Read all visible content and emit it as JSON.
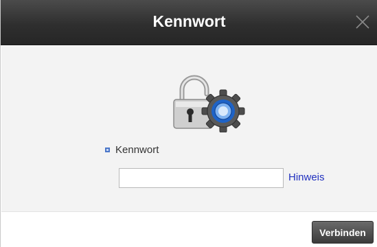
{
  "dialog": {
    "title": "Kennwort",
    "close_icon": "close-icon"
  },
  "form": {
    "icon": "lock-gear-icon",
    "password_label": "Kennwort",
    "password_value": "",
    "password_placeholder": "",
    "hint_link": "Hinweis"
  },
  "footer": {
    "connect_label": "Verbinden"
  },
  "colors": {
    "titlebar": "#2f2f2f",
    "link": "#1f2fbf",
    "bullet": "#4a76c8",
    "button": "#4a4a4a"
  }
}
